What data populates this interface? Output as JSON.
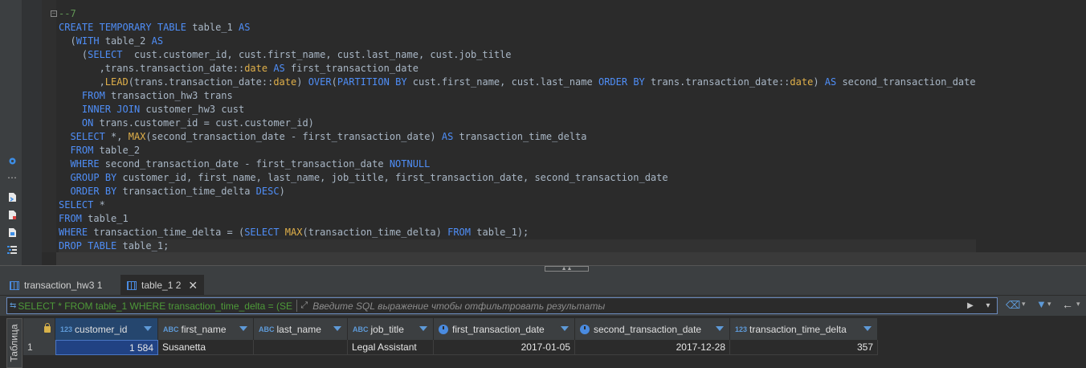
{
  "editor": {
    "lines": [
      "--7",
      "CREATE TEMPORARY TABLE table_1 AS",
      "  (WITH table_2 AS",
      "    (SELECT  cust.customer_id, cust.first_name, cust.last_name, cust.job_title",
      "       ,trans.transaction_date::date AS first_transaction_date",
      "       ,LEAD(trans.transaction_date::date) OVER(PARTITION BY cust.first_name, cust.last_name ORDER BY trans.transaction_date::date) AS second_transaction_date",
      "    FROM transaction_hw3 trans",
      "    INNER JOIN customer_hw3 cust",
      "    ON trans.customer_id = cust.customer_id)",
      "  SELECT *, MAX(second_transaction_date - first_transaction_date) AS transaction_time_delta",
      "  FROM table_2",
      "  WHERE second_transaction_date - first_transaction_date NOTNULL",
      "  GROUP BY customer_id, first_name, last_name, job_title, first_transaction_date, second_transaction_date",
      "  ORDER BY transaction_time_delta DESC)",
      "SELECT *",
      "FROM table_1",
      "WHERE transaction_time_delta = (SELECT MAX(transaction_time_delta) FROM table_1);",
      "DROP TABLE table_1;"
    ]
  },
  "left_toolbar": {
    "icons": [
      "settings-icon",
      "more-icon",
      "script-icon",
      "script-error-icon",
      "document-icon",
      "outline-icon"
    ]
  },
  "tabs": [
    {
      "label": "transaction_hw3 1",
      "active": false
    },
    {
      "label": "table_1 2",
      "active": true,
      "close": "✕"
    }
  ],
  "filter": {
    "query": "SELECT * FROM table_1 WHERE transaction_time_delta = (SEL",
    "placeholder": "Введите SQL выражение чтобы отфильтровать результаты"
  },
  "grid": {
    "side_label": "Таблица",
    "columns": [
      {
        "label": "customer_id",
        "type": "123"
      },
      {
        "label": "first_name",
        "type": "ABC"
      },
      {
        "label": "last_name",
        "type": "ABC"
      },
      {
        "label": "job_title",
        "type": "ABC"
      },
      {
        "label": "first_transaction_date",
        "type": "clock"
      },
      {
        "label": "second_transaction_date",
        "type": "clock"
      },
      {
        "label": "transaction_time_delta",
        "type": "123"
      }
    ],
    "rows": [
      {
        "num": "1",
        "cells": [
          "1 584",
          "Susanetta",
          "",
          "Legal Assistant",
          "2017-01-05",
          "2017-12-28",
          "357"
        ]
      }
    ]
  },
  "colors": {
    "keyword": "#4f8ef7",
    "function": "#e0b04a",
    "comment": "#629755",
    "filter_query": "#4e9a39",
    "selection": "#214283"
  }
}
